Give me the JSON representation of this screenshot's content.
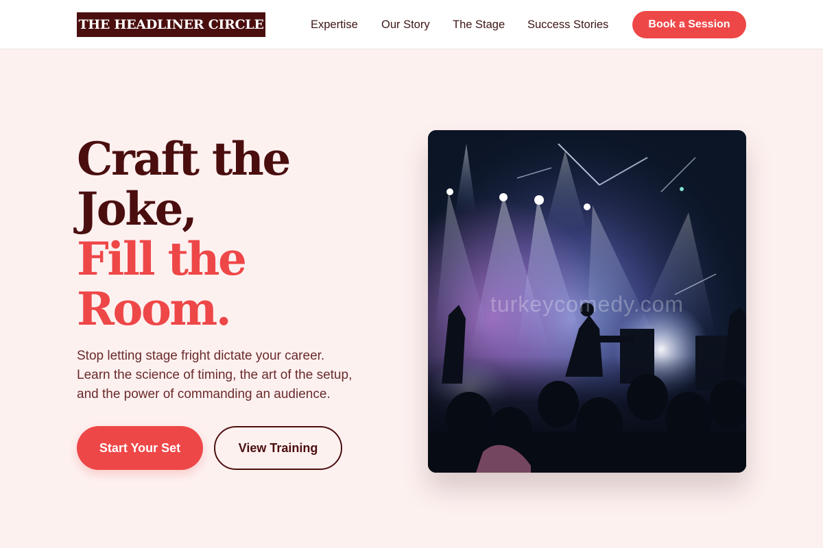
{
  "brand": {
    "logo_text": "THE HEADLINER CIRCLE"
  },
  "nav": {
    "items": [
      {
        "label": "Expertise"
      },
      {
        "label": "Our Story"
      },
      {
        "label": "The Stage"
      },
      {
        "label": "Success Stories"
      }
    ],
    "cta_label": "Book a Session"
  },
  "hero": {
    "title_lines": [
      "Craft the",
      "Joke,",
      "Fill the",
      "Room."
    ],
    "description_lines": [
      "Stop letting stage fright dictate your career.",
      "Learn the science of timing, the art of the setup,",
      "and the power of commanding an audience."
    ],
    "primary_button": "Start Your Set",
    "secondary_button": "View Training",
    "image": {
      "subject": "concert-stage-photo",
      "watermark": "turkeycomedy.com"
    }
  },
  "colors": {
    "accent": "#ee4748",
    "dark": "#4a0e0e",
    "background": "#fdf1f0",
    "header_bg": "#ffffff"
  }
}
